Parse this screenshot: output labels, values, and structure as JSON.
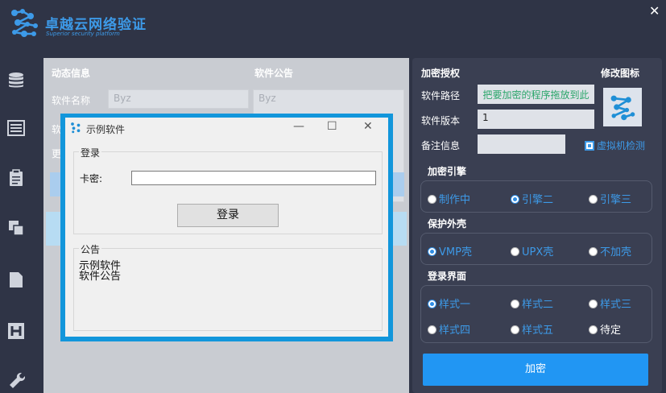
{
  "app": {
    "title": "卓越云网络验证",
    "subtitle": "Superior security platform",
    "close_glyph": "✕"
  },
  "sidebar": {
    "icons": [
      "database-icon",
      "list-icon",
      "clipboard-icon",
      "copy-icon",
      "document-icon",
      "h-icon",
      "wrench-icon"
    ]
  },
  "middle": {
    "section_dynamic": "动态信息",
    "section_notice": "软件公告",
    "software_name_label": "软件名称",
    "software_name_value": "Byz",
    "notice_value": "Byz",
    "partial_label_1": "软",
    "partial_label_2": "更"
  },
  "dialog": {
    "title": "示例软件",
    "minimize": "—",
    "maximize": "☐",
    "close": "✕",
    "login_group": "登录",
    "card_label": "卡密:",
    "card_value": "",
    "login_button": "登录",
    "notice_group": "公告",
    "notice_lines": [
      "示例软件",
      "软件公告"
    ]
  },
  "right_panel": {
    "title": "加密授权",
    "modify_icon": "修改图标",
    "path_label": "软件路径",
    "path_placeholder": "把要加密的程序拖放到此",
    "version_label": "软件版本",
    "version_value": "1",
    "remark_label": "备注信息",
    "remark_value": "",
    "vm_detect": "虚拟机检测",
    "vm_detect_checked": true,
    "engine_title": "加密引擎",
    "engine_options": [
      "制作中",
      "引擎二",
      "引擎三"
    ],
    "engine_selected": "引擎二",
    "shell_title": "保护外壳",
    "shell_options": [
      "VMP壳",
      "UPX壳",
      "不加壳"
    ],
    "shell_selected": "VMP壳",
    "ui_title": "登录界面",
    "ui_options_row1": [
      "样式一",
      "样式二",
      "样式三"
    ],
    "ui_options_row2": [
      "样式四",
      "样式五",
      "待定"
    ],
    "ui_selected": "样式一",
    "encrypt_button": "加密"
  },
  "colors": {
    "background": "#2f3446",
    "accent": "#2196f3",
    "panel": "#3a3f52",
    "dialog_frame": "#1296db"
  }
}
